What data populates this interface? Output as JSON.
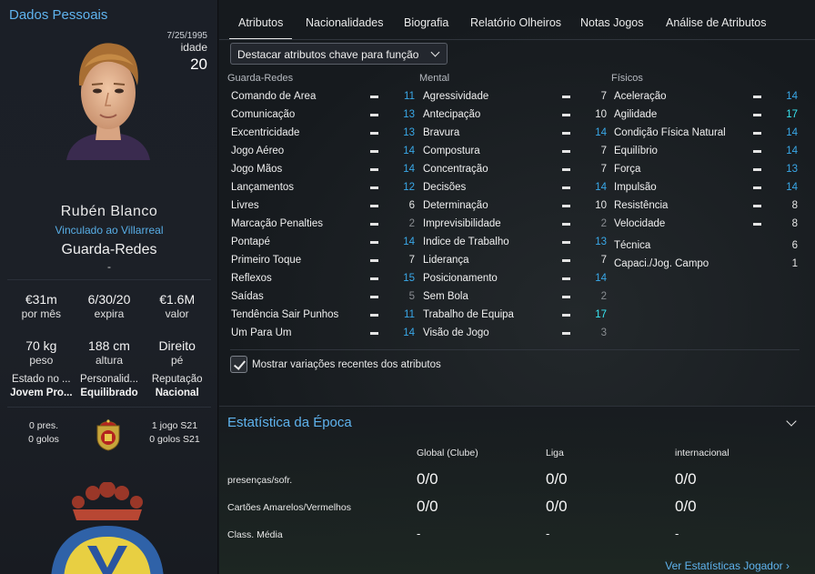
{
  "left": {
    "title": "Dados Pessoais",
    "dob": "7/25/1995",
    "age_label": "idade",
    "age": "20",
    "name": "Rubén Blanco",
    "club": "Vinculado ao Villarreal",
    "position": "Guarda-Redes",
    "position_sub": "-",
    "wage": "€31m",
    "wage_label": "por mês",
    "expires": "6/30/20",
    "expires_label": "expira",
    "value": "€1.6M",
    "value_label": "valor",
    "weight": "70 kg",
    "weight_label": "peso",
    "height": "188 cm",
    "height_label": "altura",
    "foot": "Direito",
    "foot_label": "pé",
    "status_label": "Estado no ...",
    "status": "Jovem Pro...",
    "personality_label": "Personalid...",
    "personality": "Equilibrado",
    "reputation_label": "Reputação",
    "reputation": "Nacional",
    "intl_left_apps": "0 pres.",
    "intl_left_goals": "0 golos",
    "intl_right_apps": "1 jogo S21",
    "intl_right_goals": "0 golos S21"
  },
  "tabs": [
    "Atributos",
    "Nacionalidades",
    "Biografia",
    "Relatório Olheiros",
    "Notas Jogos",
    "Análise de Atributos"
  ],
  "highlight_dropdown": "Destacar atributos chave para função",
  "columns": {
    "gk": "Guarda-Redes",
    "mental": "Mental",
    "physical": "Físicos"
  },
  "gk_attrs": [
    {
      "name": "Comando de Área",
      "value": "11",
      "color": "b"
    },
    {
      "name": "Comunicação",
      "value": "13",
      "color": "b"
    },
    {
      "name": "Excentricidade",
      "value": "13",
      "color": "b"
    },
    {
      "name": "Jogo Aéreo",
      "value": "14",
      "color": "b"
    },
    {
      "name": "Jogo Mãos",
      "value": "14",
      "color": "b"
    },
    {
      "name": "Lançamentos",
      "value": "12",
      "color": "b"
    },
    {
      "name": "Livres",
      "value": "6",
      "color": "w"
    },
    {
      "name": "Marcação Penalties",
      "value": "2",
      "color": "g"
    },
    {
      "name": "Pontapé",
      "value": "14",
      "color": "b"
    },
    {
      "name": "Primeiro Toque",
      "value": "7",
      "color": "w"
    },
    {
      "name": "Reflexos",
      "value": "15",
      "color": "b"
    },
    {
      "name": "Saídas",
      "value": "5",
      "color": "g"
    },
    {
      "name": "Tendência Sair Punhos",
      "value": "11",
      "color": "b"
    },
    {
      "name": "Um Para Um",
      "value": "14",
      "color": "b"
    }
  ],
  "mental_attrs": [
    {
      "name": "Agressividade",
      "value": "7",
      "color": "w"
    },
    {
      "name": "Antecipação",
      "value": "10",
      "color": "w"
    },
    {
      "name": "Bravura",
      "value": "14",
      "color": "b"
    },
    {
      "name": "Compostura",
      "value": "7",
      "color": "w"
    },
    {
      "name": "Concentração",
      "value": "7",
      "color": "w"
    },
    {
      "name": "Decisões",
      "value": "14",
      "color": "b"
    },
    {
      "name": "Determinação",
      "value": "10",
      "color": "w"
    },
    {
      "name": "Imprevisibilidade",
      "value": "2",
      "color": "g"
    },
    {
      "name": "Índice de Trabalho",
      "value": "13",
      "color": "b"
    },
    {
      "name": "Liderança",
      "value": "7",
      "color": "w"
    },
    {
      "name": "Posicionamento",
      "value": "14",
      "color": "b"
    },
    {
      "name": "Sem Bola",
      "value": "2",
      "color": "g"
    },
    {
      "name": "Trabalho de Equipa",
      "value": "17",
      "color": "c"
    },
    {
      "name": "Visão de Jogo",
      "value": "3",
      "color": "g"
    }
  ],
  "physical_attrs": [
    {
      "name": "Aceleração",
      "value": "14",
      "color": "b"
    },
    {
      "name": "Agilidade",
      "value": "17",
      "color": "c"
    },
    {
      "name": "Condição Física Natural",
      "value": "14",
      "color": "b"
    },
    {
      "name": "Equilíbrio",
      "value": "14",
      "color": "b"
    },
    {
      "name": "Força",
      "value": "13",
      "color": "b"
    },
    {
      "name": "Impulsão",
      "value": "14",
      "color": "b"
    },
    {
      "name": "Resistência",
      "value": "8",
      "color": "w"
    },
    {
      "name": "Velocidade",
      "value": "8",
      "color": "w"
    }
  ],
  "extra_attrs": [
    {
      "name": "Técnica",
      "value": "6"
    },
    {
      "name": "Capaci./Jog. Campo",
      "value": "1"
    }
  ],
  "checkbox_label": "Mostrar variações recentes dos atributos",
  "season": {
    "title": "Estatística da Época",
    "headers": [
      "Global (Clube)",
      "Liga",
      "internacional"
    ],
    "rows": [
      {
        "label": "presenças/sofr.",
        "values": [
          "0/0",
          "0/0",
          "0/0"
        ]
      },
      {
        "label": "Cartões Amarelos/Vermelhos",
        "values": [
          "0/0",
          "0/0",
          "0/0"
        ]
      },
      {
        "label": "Class. Média",
        "values": [
          "-",
          "-",
          "-"
        ]
      }
    ],
    "link": "Ver Estatísticas Jogador"
  },
  "colors": {
    "accent": "#5fb3ee",
    "good": "#39a8e8",
    "excellent": "#38e6f2",
    "poor": "#8a8d92"
  }
}
